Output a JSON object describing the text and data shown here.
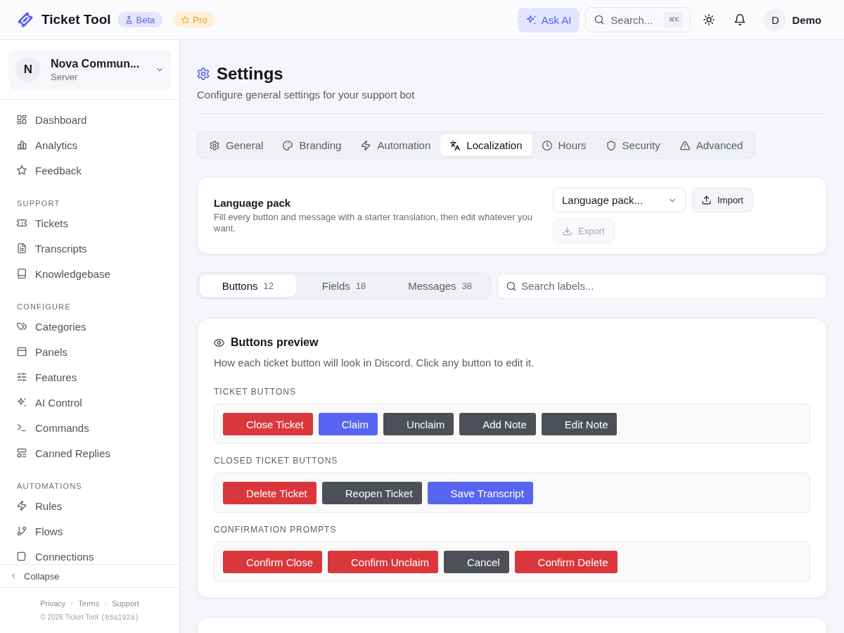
{
  "topbar": {
    "app_name": "Ticket Tool",
    "badges": [
      {
        "kind": "beta",
        "label": "Beta"
      },
      {
        "kind": "pro",
        "label": "Pro"
      }
    ],
    "ask_ai": "Ask AI",
    "search": {
      "placeholder": "Search...",
      "shortcut": "⌘K"
    },
    "user": {
      "initial": "D",
      "name": "Demo"
    }
  },
  "sidebar": {
    "server": {
      "initial": "N",
      "name": "Nova Commun...",
      "subtitle": "Server"
    },
    "sections": [
      {
        "items": [
          {
            "label": "Dashboard",
            "selected": false
          },
          {
            "label": "Analytics",
            "selected": false
          },
          {
            "label": "Feedback",
            "selected": false
          }
        ]
      },
      {
        "heading": "SUPPORT",
        "items": [
          {
            "label": "Tickets",
            "selected": false
          },
          {
            "label": "Transcripts",
            "selected": false
          },
          {
            "label": "Knowledgebase",
            "selected": false
          }
        ]
      },
      {
        "heading": "CONFIGURE",
        "items": [
          {
            "label": "Categories",
            "selected": false
          },
          {
            "label": "Panels",
            "selected": false
          },
          {
            "label": "Features",
            "selected": false
          },
          {
            "label": "AI Control",
            "selected": false
          },
          {
            "label": "Commands",
            "selected": false
          },
          {
            "label": "Canned Replies",
            "selected": false
          }
        ]
      },
      {
        "heading": "AUTOMATIONS",
        "items": [
          {
            "label": "Rules",
            "selected": false
          },
          {
            "label": "Flows",
            "selected": false
          },
          {
            "label": "Connections",
            "selected": false
          }
        ]
      }
    ],
    "collapse": "Collapse",
    "footer": {
      "links": [
        "Privacy",
        "Terms",
        "Support"
      ],
      "copyright": "© 2026 Ticket Tool",
      "build": "(b5a192a)"
    }
  },
  "page": {
    "title": "Settings",
    "subtitle": "Configure general settings for your support bot",
    "tabs": [
      {
        "label": "General",
        "selected": false
      },
      {
        "label": "Branding",
        "selected": false
      },
      {
        "label": "Automation",
        "selected": false
      },
      {
        "label": "Localization",
        "selected": true
      },
      {
        "label": "Hours",
        "selected": false
      },
      {
        "label": "Security",
        "selected": false
      },
      {
        "label": "Advanced",
        "selected": false
      }
    ]
  },
  "language_pack": {
    "title": "Language pack",
    "description": "Fill every button and message with a starter translation, then edit whatever you want.",
    "select": {
      "value": "Language pack..."
    },
    "actions": [
      {
        "kind": "import",
        "label": "Import",
        "disabled": false
      },
      {
        "kind": "export",
        "label": "Export",
        "disabled": true
      }
    ]
  },
  "label_tabs": [
    {
      "label": "Buttons",
      "count": "12",
      "selected": true
    },
    {
      "label": "Fields",
      "count": "18",
      "selected": false
    },
    {
      "label": "Messages",
      "count": "38",
      "selected": false
    }
  ],
  "label_search": {
    "placeholder": "Search labels..."
  },
  "preview": {
    "title": "Buttons preview",
    "description": "How each ticket button will look in Discord. Click any button to edit it.",
    "groups": [
      {
        "heading": "TICKET BUTTONS",
        "buttons": [
          {
            "label": "Close Ticket",
            "kind": "danger"
          },
          {
            "label": "Claim",
            "kind": "primary"
          },
          {
            "label": "Unclaim",
            "kind": "secondary"
          },
          {
            "label": "Add Note",
            "kind": "secondary"
          },
          {
            "label": "Edit Note",
            "kind": "secondary"
          }
        ]
      },
      {
        "heading": "CLOSED TICKET BUTTONS",
        "buttons": [
          {
            "label": "Delete Ticket",
            "kind": "danger"
          },
          {
            "label": "Reopen Ticket",
            "kind": "secondary"
          },
          {
            "label": "Save Transcript",
            "kind": "primary"
          }
        ]
      },
      {
        "heading": "CONFIRMATION PROMPTS",
        "buttons": [
          {
            "label": "Confirm Close",
            "kind": "danger"
          },
          {
            "label": "Confirm Unclaim",
            "kind": "danger"
          },
          {
            "label": "Cancel",
            "kind": "secondary"
          },
          {
            "label": "Confirm Delete",
            "kind": "danger"
          }
        ]
      }
    ]
  }
}
